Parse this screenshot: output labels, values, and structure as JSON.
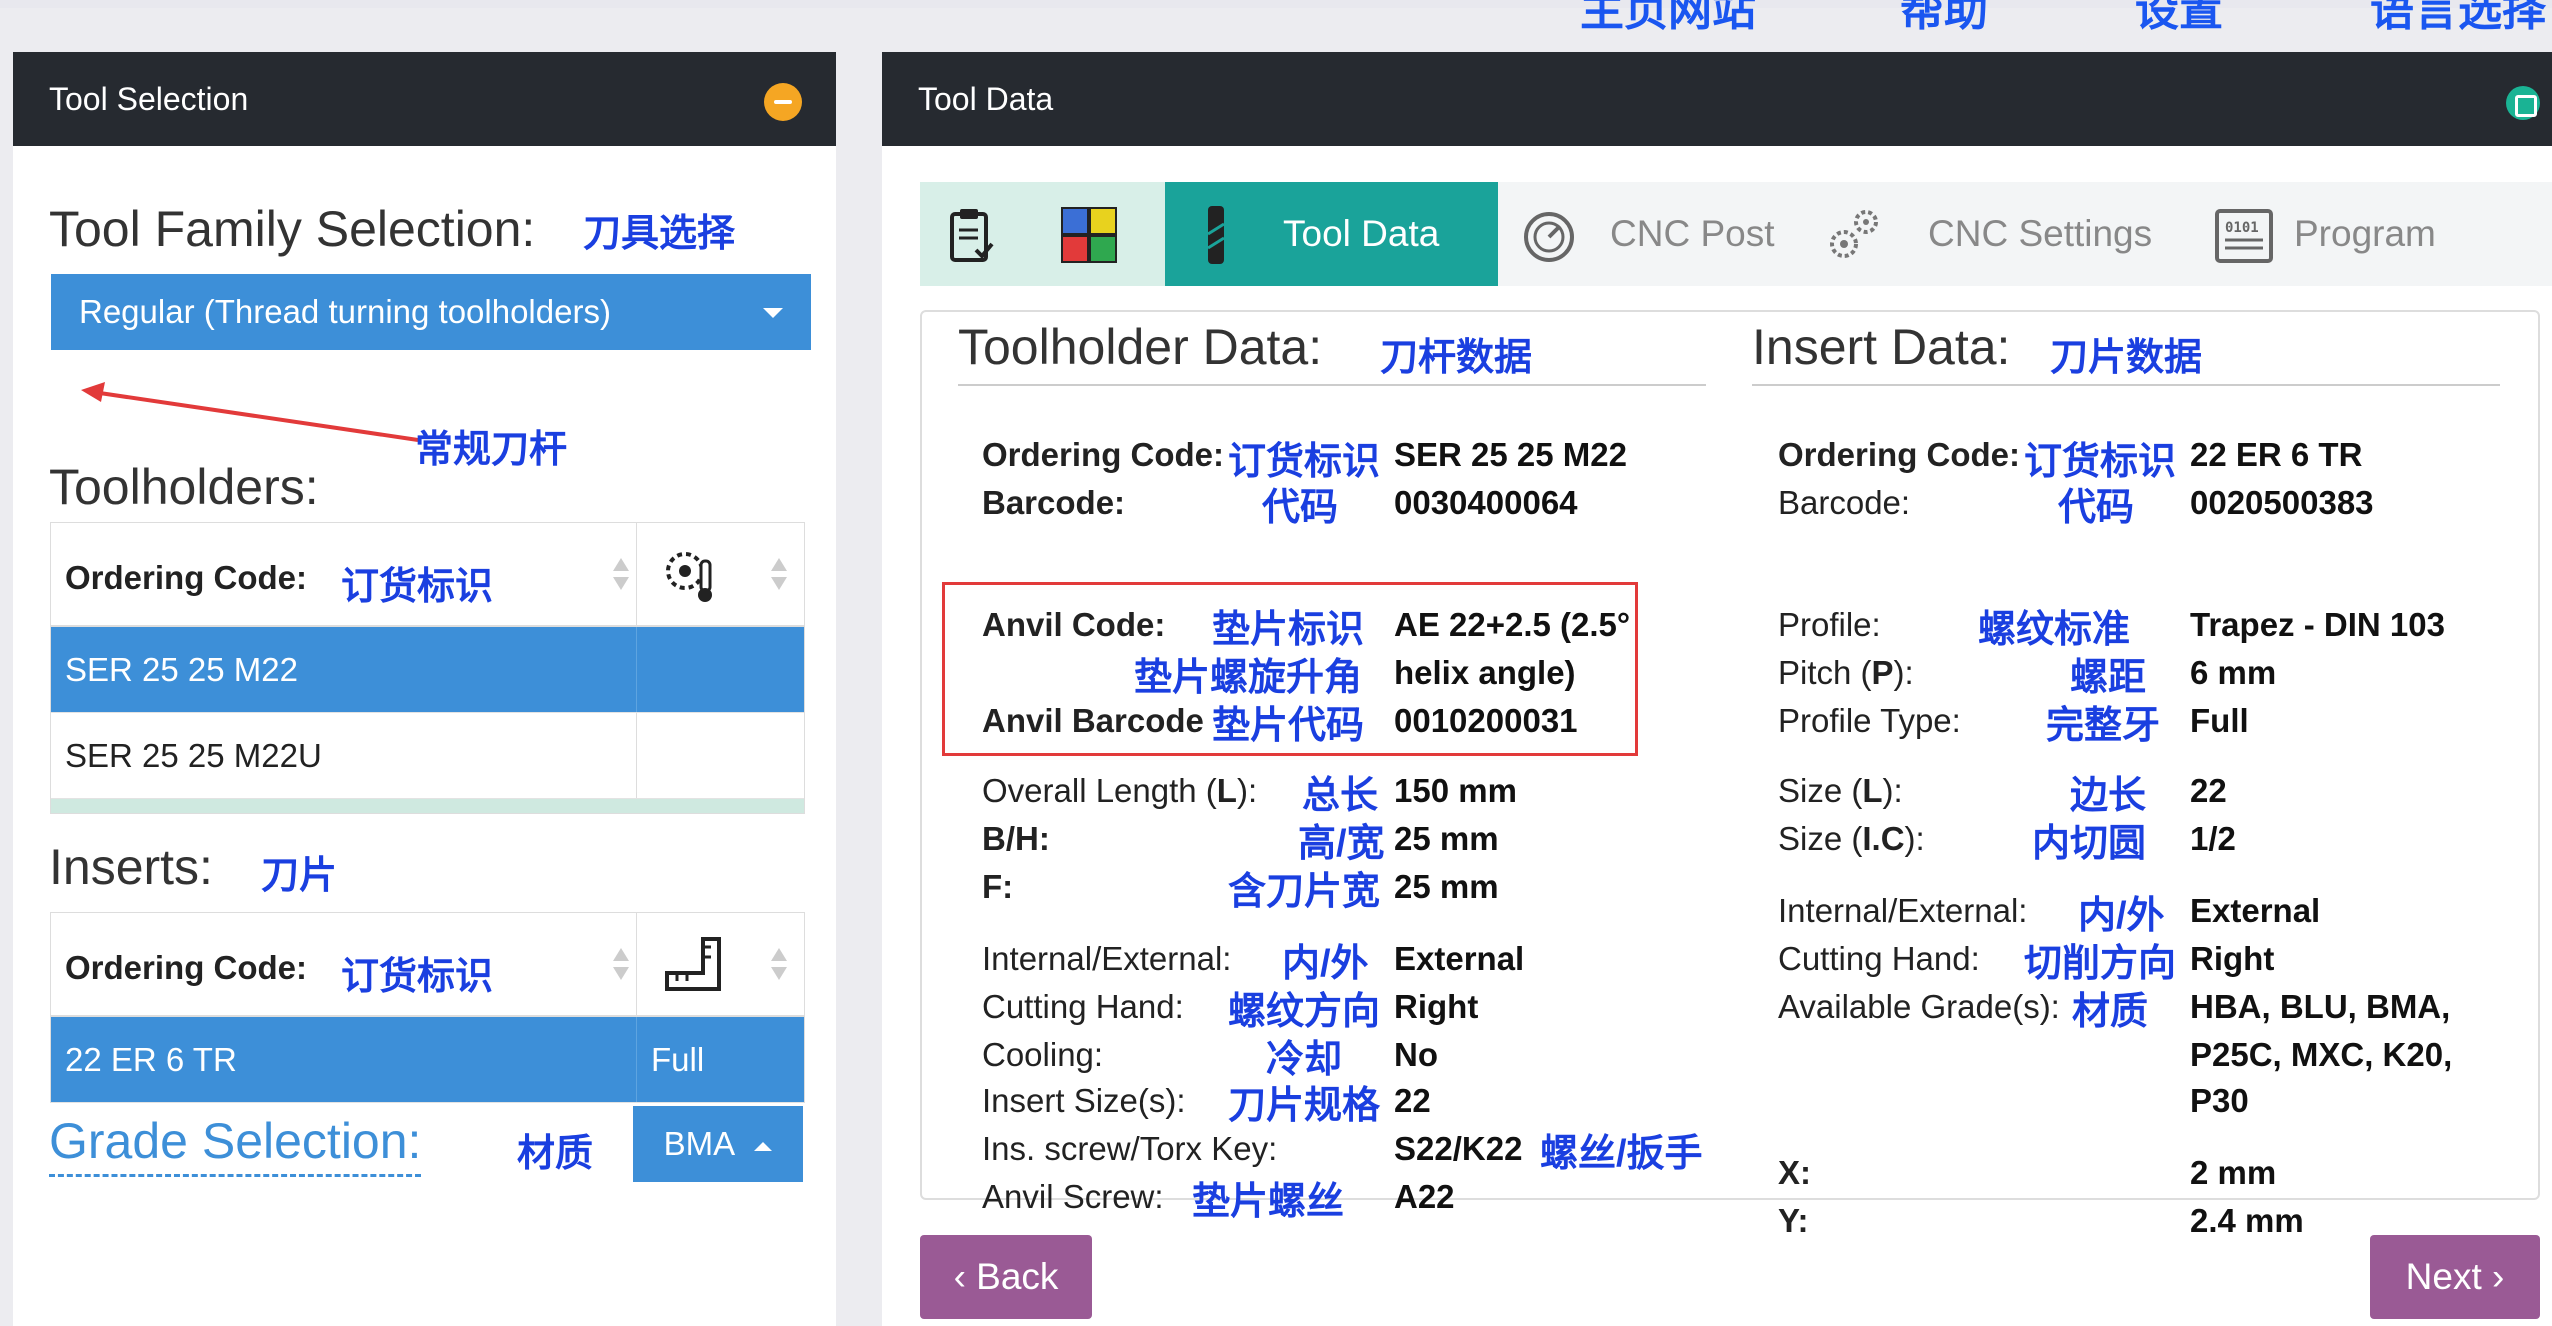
{
  "topnav": [
    "主页网站",
    "帮助",
    "设置",
    "语言选择"
  ],
  "left_panel": {
    "title": "Tool Selection",
    "family_label": "Tool Family Selection:",
    "family_cn": "刀具选择",
    "family_value": "Regular (Thread turning toolholders)",
    "family_note_cn": "常规刀杆",
    "toolholders_label": "Toolholders:",
    "toolholders": {
      "header": "Ordering Code:",
      "header_cn": "订货标识",
      "rows": [
        {
          "code": "SER 25 25 M22",
          "extra": ""
        },
        {
          "code": "SER 25 25 M22U",
          "extra": ""
        }
      ]
    },
    "inserts_label": "Inserts:",
    "inserts_cn": "刀片",
    "inserts": {
      "header": "Ordering Code:",
      "header_cn": "订货标识",
      "rows": [
        {
          "code": "22 ER 6 TR",
          "extra": "Full"
        }
      ]
    },
    "grade_label": "Grade Selection:",
    "grade_cn": "材质",
    "grade_value": "BMA"
  },
  "right_panel": {
    "title": "Tool Data",
    "tabs": [
      {
        "label": "Tool Data"
      },
      {
        "label": "CNC Post"
      },
      {
        "label": "CNC Settings"
      },
      {
        "label": "Program"
      }
    ],
    "toolholder": {
      "title": "Toolholder Data:",
      "title_cn": "刀杆数据",
      "ordering_code_label": "Ordering Code:",
      "ordering_code_cn": "订货标识",
      "ordering_code": "SER 25 25 M22",
      "barcode_label": "Barcode:",
      "barcode_cn": "代码",
      "barcode": "0030400064",
      "anvil_code_label": "Anvil Code:",
      "anvil_code_cn": "垫片标识",
      "anvil_code": "AE 22+2.5 (2.5°",
      "anvil_helix_cn": "垫片螺旋升角",
      "anvil_helix": "helix angle)",
      "anvil_barcode_label": "Anvil Barcode",
      "anvil_barcode_cn": "垫片代码",
      "anvil_barcode": "0010200031",
      "overall_length_label_a": "Overall Length (",
      "overall_length_label_b": "L",
      "overall_length_label_c": "):",
      "overall_length_cn": "总长",
      "overall_length": "150 mm",
      "bh_label": "B/H:",
      "bh_cn": "高/宽",
      "bh": "25 mm",
      "f_label": "F:",
      "f_cn": "含刀片宽",
      "f": "25 mm",
      "ie_label": "Internal/External:",
      "ie_cn": "内/外",
      "ie": "External",
      "hand_label": "Cutting Hand:",
      "hand_cn": "螺纹方向",
      "hand": "Right",
      "cooling_label": "Cooling:",
      "cooling_cn": "冷却",
      "cooling": "No",
      "insert_size_label": "Insert Size(s):",
      "insert_size_cn": "刀片规格",
      "insert_size": "22",
      "screw_label": "Ins. screw/Torx Key:",
      "screw": "S22/K22",
      "screw_cn": "螺丝/扳手",
      "anvil_screw_label": "Anvil Screw:",
      "anvil_screw_cn": "垫片螺丝",
      "anvil_screw": "A22"
    },
    "insert": {
      "title": "Insert Data:",
      "title_cn": "刀片数据",
      "ordering_code_label": "Ordering Code:",
      "ordering_code_cn": "订货标识",
      "ordering_code": "22 ER 6 TR",
      "barcode_label": "Barcode:",
      "barcode_cn": "代码",
      "barcode": "0020500383",
      "profile_label": "Profile:",
      "profile_cn": "螺纹标准",
      "profile": "Trapez - DIN 103",
      "pitch_label_a": "Pitch (",
      "pitch_label_b": "P",
      "pitch_label_c": "):",
      "pitch_cn": "螺距",
      "pitch": "6 mm",
      "ptype_label": "Profile Type:",
      "ptype_cn": "完整牙",
      "ptype": "Full",
      "size_l_label_a": "Size (",
      "size_l_label_b": "L",
      "size_l_label_c": "):",
      "size_l_cn": "边长",
      "size_l": "22",
      "size_ic_label_a": "Size (",
      "size_ic_label_b": "I.C",
      "size_ic_label_c": "):",
      "size_ic_cn": "内切圆",
      "size_ic": "1/2",
      "ie_label": "Internal/External:",
      "ie_cn": "内/外",
      "ie": "External",
      "hand_label": "Cutting Hand:",
      "hand_cn": "切削方向",
      "hand": "Right",
      "grades_label": "Available Grade(s):",
      "grades_cn": "材质",
      "grades_1": "HBA, BLU, BMA,",
      "grades_2": "P25C, MXC, K20,",
      "grades_3": "P30",
      "x_label": "X:",
      "x": "2 mm",
      "y_label": "Y:",
      "y": "2.4 mm"
    },
    "back": "Back",
    "next": "Next"
  },
  "colors": {
    "accent_blue": "#3d8fd8",
    "teal": "#1aa39a",
    "nav_purple": "#9a5a95",
    "annotation_blue": "#1a3fe0",
    "red_box": "#e23a3a"
  }
}
